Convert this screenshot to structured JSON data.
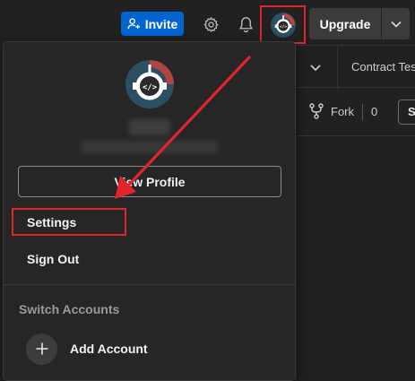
{
  "header": {
    "invite_label": "Invite",
    "upgrade_label": "Upgrade",
    "icons": [
      "add-user-icon",
      "gear-icon",
      "bell-icon",
      "avatar-icon",
      "chevron-down-icon"
    ]
  },
  "workspace": {
    "tab_label": "Contract Tes",
    "fork_label": "Fork",
    "fork_count": "0",
    "partial_button_label": "S"
  },
  "profile_menu": {
    "view_profile_label": "View Profile",
    "items": [
      {
        "label": "Settings",
        "highlighted": true
      },
      {
        "label": "Sign Out",
        "highlighted": false
      }
    ],
    "switch_accounts_title": "Switch Accounts",
    "add_account_label": "Add Account"
  },
  "colors": {
    "background": "#212121",
    "panel": "#262626",
    "invite_blue": "#0265d2",
    "annotation_red": "#e0262b",
    "upgrade_button": "#3b3b3b"
  }
}
